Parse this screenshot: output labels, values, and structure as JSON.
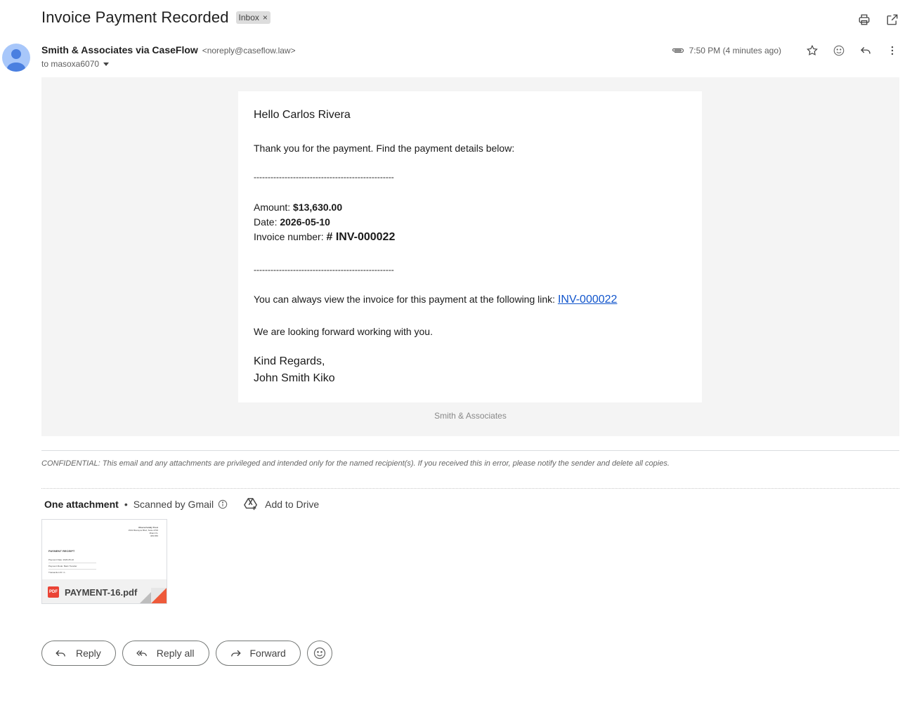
{
  "email": {
    "subject": "Invoice Payment Recorded",
    "label": "Inbox",
    "label_close": "×",
    "sender_name": "Smith & Associates via CaseFlow",
    "sender_email": "<noreply@caseflow.law>",
    "to": "to masoxa6070",
    "time": "7:50 PM (4 minutes ago)"
  },
  "body": {
    "greeting": "Hello Carlos Rivera",
    "intro": "Thank you for the payment. Find the payment details below:",
    "separator": "--------------------------------------------------",
    "amount_label": "Amount: ",
    "amount_value": "$13,630.00",
    "date_label": "Date: ",
    "date_value": "2026-05-10",
    "invoice_label": "Invoice number: ",
    "invoice_value": "# INV-000022",
    "link_text": "You can always view the invoice for this payment at the following link: ",
    "link_label": "INV-000022",
    "closing": "We are looking forward working with you.",
    "regards": "Kind Regards,",
    "signature": "John Smith Kiko",
    "footer_brand": "Smith & Associates"
  },
  "confidential": "CONFIDENTIAL: This email and any attachments are privileged and intended only for the named recipient(s). If you received this in error, please notify the sender and delete all copies.",
  "attachments": {
    "count_label": "One attachment",
    "dot": "•",
    "scanned": "Scanned by Gmail",
    "add_to_drive": "Add to Drive",
    "file_name": "PAYMENT-16.pdf",
    "file_badge": "PDF",
    "thumb": {
      "firm": "Rivera Family Trust",
      "addr1": "1501 Biscayne Blvd, Suite 2700",
      "addr2": "Miami FL",
      "addr3": "305-555",
      "title": "PAYMENT RECEIPT",
      "line1": "Payment Date: 2026-05-10",
      "line2": "Payment Mode: Bank Transfer",
      "line3": "Transaction ID: 4..."
    }
  },
  "actions": {
    "reply": "Reply",
    "reply_all": "Reply all",
    "forward": "Forward"
  },
  "colors": {
    "link": "#1155cc",
    "avatar": "#a8c7fa",
    "pdf": "#ea4335"
  }
}
